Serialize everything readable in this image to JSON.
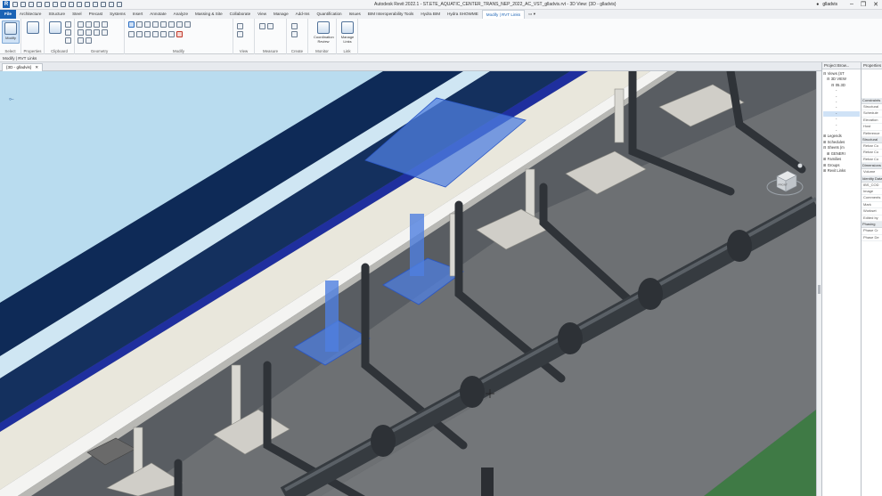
{
  "app": {
    "window_title": "Autodesk Revit 2022.1 - ST.ETE_AQUATIC_CENTER_TRANS_NEP_2022_AC_VST_glladvis.rvt - 3D View: {3D - glladvis}",
    "user": "glladvis",
    "logo": "R"
  },
  "tabs": [
    {
      "label": "File"
    },
    {
      "label": "Architecture"
    },
    {
      "label": "Structure"
    },
    {
      "label": "Steel"
    },
    {
      "label": "Precast"
    },
    {
      "label": "Systems"
    },
    {
      "label": "Insert"
    },
    {
      "label": "Annotate"
    },
    {
      "label": "Analyze"
    },
    {
      "label": "Massing & Site"
    },
    {
      "label": "Collaborate"
    },
    {
      "label": "View"
    },
    {
      "label": "Manage"
    },
    {
      "label": "Add-Ins"
    },
    {
      "label": "Quantification"
    },
    {
      "label": "Issues"
    },
    {
      "label": "BIM Interoperability Tools"
    },
    {
      "label": "Hydra BIM"
    },
    {
      "label": "Hydra SHOWME"
    },
    {
      "label": "Modify | RVT Links"
    }
  ],
  "ribbon": {
    "panels": {
      "select": "Select",
      "properties": "Properties",
      "clipboard": "Clipboard",
      "geometry": "Geometry",
      "modify": "Modify",
      "view": "View",
      "measure": "Measure",
      "create": "Create",
      "monitor": "Monitor",
      "link": "Link"
    },
    "buttons": {
      "modify": "Modify",
      "coordination_review": "Coordination Review",
      "manage_links": "Manage Links"
    }
  },
  "options_bar": {
    "text": "Modify | RVT Links"
  },
  "view_tab": {
    "label": "{3D - glladvis}",
    "close": "✕"
  },
  "project_browser": {
    "title": "Project Brow...",
    "nodes": [
      {
        "label": "Views (ST",
        "level": 0
      },
      {
        "label": "3D VIEW",
        "level": 1
      },
      {
        "label": "05.3D",
        "level": 2
      },
      {
        "label": "",
        "level": 3
      },
      {
        "label": "",
        "level": 3
      },
      {
        "label": "",
        "level": 3
      },
      {
        "label": "",
        "level": 3
      },
      {
        "label": "",
        "level": 3
      },
      {
        "label": "",
        "level": 3
      },
      {
        "label": "",
        "level": 3
      },
      {
        "label": "",
        "level": 3
      },
      {
        "label": "Legends",
        "level": 0
      },
      {
        "label": "Schedules",
        "level": 0
      },
      {
        "label": "Sheets (m",
        "level": 0
      },
      {
        "label": "GENERI",
        "level": 1
      },
      {
        "label": "Families",
        "level": 0
      },
      {
        "label": "Groups",
        "level": 0
      },
      {
        "label": "Revit Links",
        "level": 0
      }
    ]
  },
  "properties_panel": {
    "title": "Properties",
    "rows": [
      {
        "group": "Constraints",
        "items": [
          "Structural",
          "Schedule",
          "Elevation",
          "Host",
          "Reference"
        ]
      },
      {
        "group": "Structural",
        "items": [
          "Rebar Co",
          "Rebar Co",
          "Rebar Co"
        ]
      },
      {
        "group": "Dimensions",
        "items": [
          "Volume"
        ]
      },
      {
        "group": "Identity Data",
        "items": [
          "IBS_COD",
          "Image",
          "Comments",
          "Mark",
          "Workset",
          "Edited by"
        ]
      },
      {
        "group": "Phasing",
        "items": [
          "Phase Cr",
          "Phase De"
        ]
      }
    ]
  },
  "viewcube": {
    "face": "FRONT"
  },
  "colors": {
    "accent": "#1b63b5",
    "selection_blue": "#4f7fe0",
    "navy_band": "#0e2a57",
    "deep_blue": "#1f2f9e",
    "sky": "#b9dcef",
    "pipe": "#3a3f45",
    "concrete": "#c9c9c6",
    "green": "#3f7a45"
  }
}
